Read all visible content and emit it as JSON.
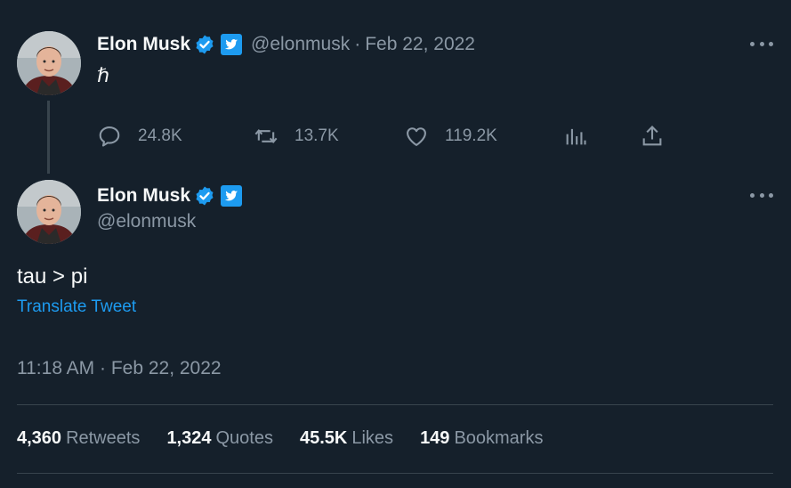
{
  "first_tweet": {
    "author_name": "Elon Musk",
    "handle": "@elonmusk",
    "separator": "·",
    "date": "Feb 22, 2022",
    "text": "ℏ",
    "actions": {
      "replies": "24.8K",
      "retweets": "13.7K",
      "likes": "119.2K"
    }
  },
  "second_tweet": {
    "author_name": "Elon Musk",
    "handle": "@elonmusk",
    "text": "tau > pi",
    "translate_label": "Translate Tweet",
    "timestamp": "11:18 AM · Feb 22, 2022",
    "stats": [
      {
        "value": "4,360",
        "label": "Retweets"
      },
      {
        "value": "1,324",
        "label": "Quotes"
      },
      {
        "value": "45.5K",
        "label": "Likes"
      },
      {
        "value": "149",
        "label": "Bookmarks"
      }
    ]
  },
  "colors": {
    "background": "#15202b",
    "text": "#f7f9f9",
    "muted": "#8b98a5",
    "accent": "#1d9bf0",
    "divider": "#38444d"
  },
  "icons": [
    "verified-badge-icon",
    "twitter-bird-icon",
    "more-icon",
    "reply-icon",
    "retweet-icon",
    "like-icon",
    "analytics-icon",
    "share-icon"
  ]
}
